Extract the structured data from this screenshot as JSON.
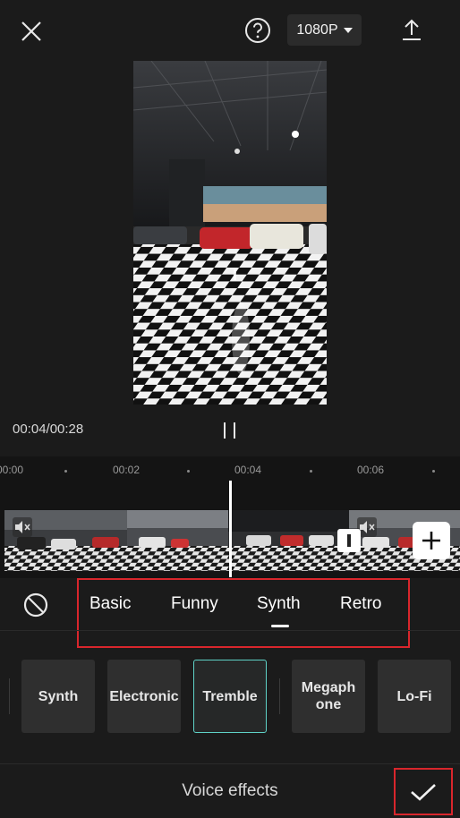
{
  "topbar": {
    "close_icon": "close-icon",
    "help_icon": "help-icon",
    "resolution": "1080P",
    "export_icon": "export-icon"
  },
  "player": {
    "time": "00:04/00:28",
    "pause_icon": "pause-icon"
  },
  "timeline": {
    "ticks": [
      "00:00",
      "00:02",
      "00:04",
      "00:06"
    ],
    "add_icon": "plus-icon",
    "transition_icon": "transition-icon",
    "mute_icon": "speaker-muted-icon"
  },
  "categories": {
    "none_icon": "none-icon",
    "tabs": [
      "Basic",
      "Funny",
      "Synth",
      "Retro"
    ],
    "active": "Synth"
  },
  "effects": {
    "items": [
      "Synth",
      "Electronic",
      "Tremble",
      "Megaph one",
      "Lo-Fi"
    ],
    "selected": "Tremble"
  },
  "bottom": {
    "title": "Voice effects",
    "confirm_icon": "checkmark-icon"
  },
  "colors": {
    "background": "#1b1b1b",
    "highlight_border": "#d9262c",
    "selected_tile_border": "#5fd3c8"
  }
}
